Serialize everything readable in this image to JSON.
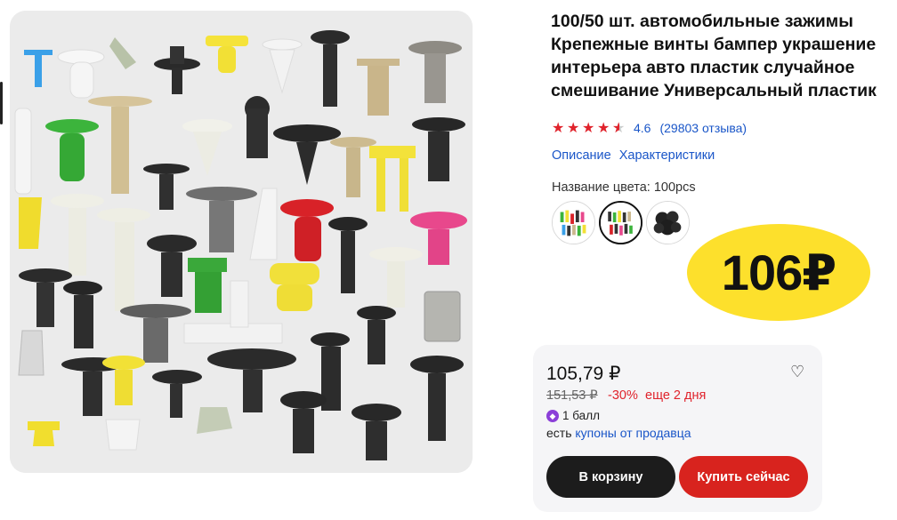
{
  "product": {
    "title": "100/50 шт. автомобильные зажимы Крепежные винты бампер украшение интерьера авто пластик случайное смешивание Универсальный пластик",
    "image_icon": "car-clips-assortment-photo"
  },
  "rating": {
    "value": "4.6",
    "stars": 4.6,
    "reviews": "(29803 отзыва)",
    "star_color": "#e0232c"
  },
  "links": {
    "description": "Описание",
    "specs": "Характеристики"
  },
  "color": {
    "label": "Название цвета: 100pcs",
    "options": [
      "mixed-color-clips",
      "mixed-color-clips-alt",
      "black-clips"
    ],
    "selected_index": 1
  },
  "price_badge": {
    "text": "106₽",
    "color": "#fde02c"
  },
  "buy_card": {
    "price": "105,79 ₽",
    "old_price": "151,53 ₽",
    "discount": "-30%",
    "discount_extra": "еще 2 дня",
    "points": "1 балл",
    "coupons_prefix": "есть",
    "coupons_link": "купоны от продавца",
    "favorite_icon": "heart-icon",
    "cart_button": "В корзину",
    "buy_button": "Купить сейчас"
  },
  "colors": {
    "link": "#1a56c8",
    "accent_red": "#d8231e",
    "dark_button": "#1c1c1c"
  }
}
